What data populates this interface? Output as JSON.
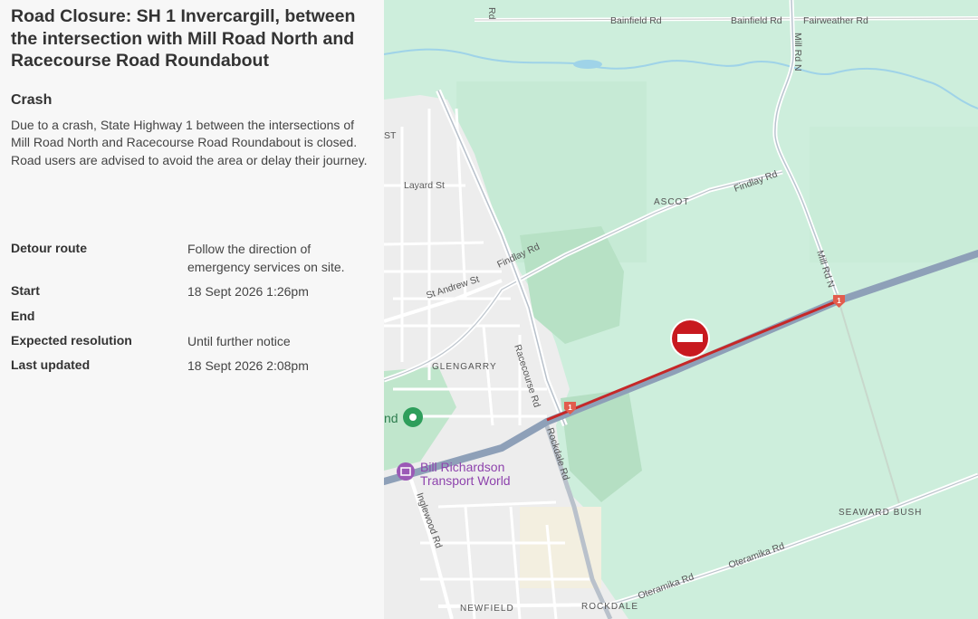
{
  "incident": {
    "title": "Road Closure: SH 1 Invercargill, between the intersection with Mill Road North and Racecourse Road Roundabout",
    "type": "Crash",
    "description": "Due to a crash, State Highway 1 between the intersections of Mill Road North and Racecourse Road Roundabout is closed. Road users are advised to avoid the area or delay their journey."
  },
  "details": [
    {
      "label": "Detour route",
      "value": "Follow the direction of emergency services on site."
    },
    {
      "label": "Start",
      "value": "18 Sept 2026 1:26pm"
    },
    {
      "label": "End",
      "value": ""
    },
    {
      "label": "Expected resolution",
      "value": "Until further notice"
    },
    {
      "label": "Last updated",
      "value": "18 Sept 2026 2:08pm"
    }
  ],
  "map": {
    "roads": {
      "bainfield_1": "Bainfield Rd",
      "bainfield_2": "Bainfield Rd",
      "fairweather": "Fairweather Rd",
      "mill_rd_n_top": "Mill Rd N",
      "mill_rd_n": "Mill Rd N",
      "layard": "Layard St",
      "findlay_1": "Findlay Rd",
      "findlay_2": "Findlay Rd",
      "st_andrew": "St Andrew St",
      "racecourse": "Racecourse Rd",
      "rockdale": "Rockdale Rd",
      "inglewood": "Inglewood Rd",
      "oteramika_1": "Oteramika Rd",
      "oteramika_2": "Oteramika Rd",
      "st_partial": "ST",
      "rd_partial": "Rd",
      "nd_partial": "nd"
    },
    "areas": {
      "ascot": "ASCOT",
      "glengarry": "GLENGARRY",
      "seaward_bush": "SEAWARD BUSH",
      "newfield": "NEWFIELD",
      "rockdale": "ROCKDALE"
    },
    "poi": "Bill Richardson Transport World",
    "highway_shield": "1",
    "colors": {
      "closure": "#c62828",
      "green": "#cdeedc",
      "urban": "#efefef",
      "highway": "#8ea0b8"
    }
  }
}
